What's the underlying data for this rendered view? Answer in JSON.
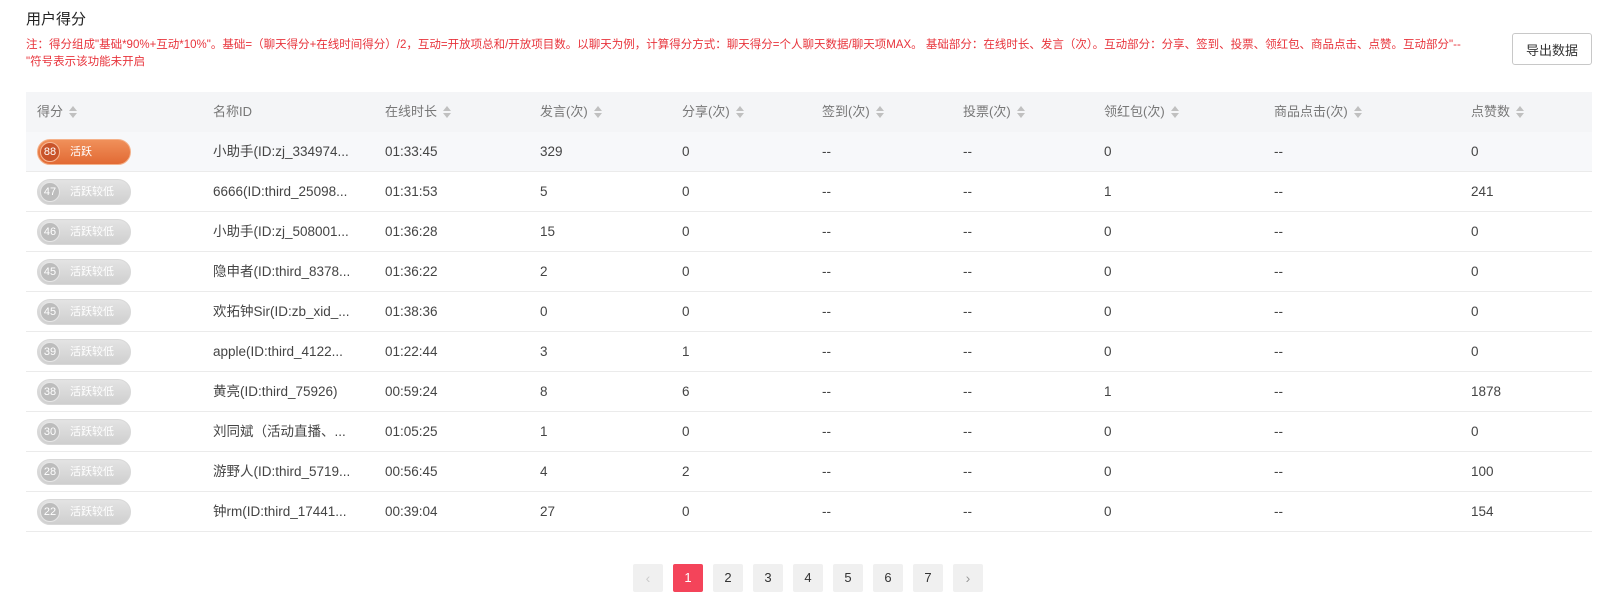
{
  "page": {
    "title": "用户得分",
    "note": "注：得分组成\"基础*90%+互动*10%\"。基础=（聊天得分+在线时间得分）/2，互动=开放项总和/开放项目数。以聊天为例，计算得分方式：聊天得分=个人聊天数据/聊天项MAX。 基础部分：在线时长、发言（次）。互动部分：分享、签到、投票、领红包、商品点击、点赞。互动部分\"--\"符号表示该功能未开启",
    "export_label": "导出数据"
  },
  "colors": {
    "note_red": "#e8343c",
    "active_badge": "#e26a34",
    "pager_active": "#f4445a"
  },
  "table": {
    "headers": [
      "得分",
      "名称ID",
      "在线时长",
      "发言(次)",
      "分享(次)",
      "签到(次)",
      "投票(次)",
      "领红包(次)",
      "商品点击(次)",
      "点赞数"
    ],
    "rows": [
      {
        "score": "88",
        "level": "活跃",
        "name": "小助手(ID:zj_334974...",
        "online": "01:33:45",
        "speak": "329",
        "share": "0",
        "checkin": "--",
        "vote": "--",
        "redpack": "0",
        "click": "--",
        "likes": "0"
      },
      {
        "score": "47",
        "level": "活跃较低",
        "name": "6666(ID:third_25098...",
        "online": "01:31:53",
        "speak": "5",
        "share": "0",
        "checkin": "--",
        "vote": "--",
        "redpack": "1",
        "click": "--",
        "likes": "241"
      },
      {
        "score": "46",
        "level": "活跃较低",
        "name": "小助手(ID:zj_508001...",
        "online": "01:36:28",
        "speak": "15",
        "share": "0",
        "checkin": "--",
        "vote": "--",
        "redpack": "0",
        "click": "--",
        "likes": "0"
      },
      {
        "score": "45",
        "level": "活跃较低",
        "name": "隐申者(ID:third_8378...",
        "online": "01:36:22",
        "speak": "2",
        "share": "0",
        "checkin": "--",
        "vote": "--",
        "redpack": "0",
        "click": "--",
        "likes": "0"
      },
      {
        "score": "45",
        "level": "活跃较低",
        "name": "欢拓钟Sir(ID:zb_xid_...",
        "online": "01:38:36",
        "speak": "0",
        "share": "0",
        "checkin": "--",
        "vote": "--",
        "redpack": "0",
        "click": "--",
        "likes": "0"
      },
      {
        "score": "39",
        "level": "活跃较低",
        "name": "apple(ID:third_4122...",
        "online": "01:22:44",
        "speak": "3",
        "share": "1",
        "checkin": "--",
        "vote": "--",
        "redpack": "0",
        "click": "--",
        "likes": "0"
      },
      {
        "score": "38",
        "level": "活跃较低",
        "name": "黄亮(ID:third_75926)",
        "online": "00:59:24",
        "speak": "8",
        "share": "6",
        "checkin": "--",
        "vote": "--",
        "redpack": "1",
        "click": "--",
        "likes": "1878"
      },
      {
        "score": "30",
        "level": "活跃较低",
        "name": "刘同斌（活动直播、...",
        "online": "01:05:25",
        "speak": "1",
        "share": "0",
        "checkin": "--",
        "vote": "--",
        "redpack": "0",
        "click": "--",
        "likes": "0"
      },
      {
        "score": "28",
        "level": "活跃较低",
        "name": "游野人(ID:third_5719...",
        "online": "00:56:45",
        "speak": "4",
        "share": "2",
        "checkin": "--",
        "vote": "--",
        "redpack": "0",
        "click": "--",
        "likes": "100"
      },
      {
        "score": "22",
        "level": "活跃较低",
        "name": "钟rm(ID:third_17441...",
        "online": "00:39:04",
        "speak": "27",
        "share": "0",
        "checkin": "--",
        "vote": "--",
        "redpack": "0",
        "click": "--",
        "likes": "154"
      }
    ]
  },
  "pagination": {
    "prev": "‹",
    "next": "›",
    "pages": [
      "1",
      "2",
      "3",
      "4",
      "5",
      "6",
      "7"
    ],
    "current": "1"
  }
}
